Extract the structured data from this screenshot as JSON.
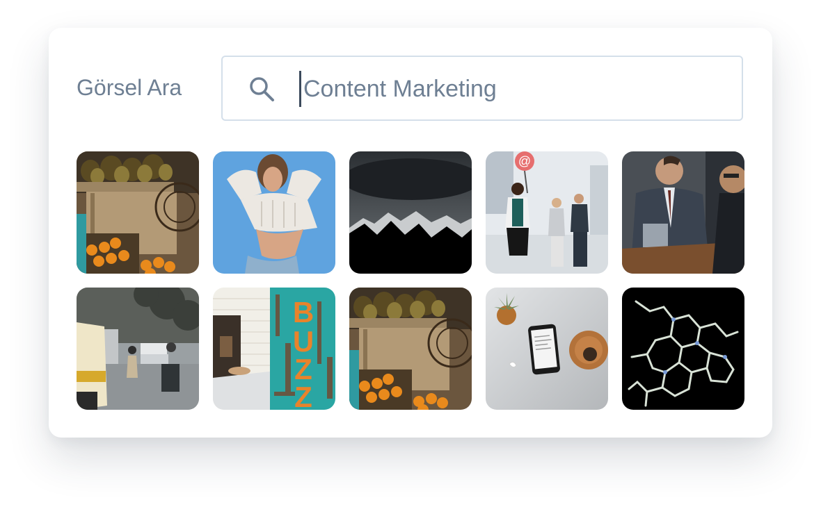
{
  "search": {
    "label": "Görsel Ara",
    "value": "Content Marketing",
    "icon": "search-icon"
  },
  "colors": {
    "label": "#6e7f93",
    "border": "#d4dfea",
    "caret": "#3c4a5c"
  },
  "images": [
    {
      "name": "fruit-stand-photo"
    },
    {
      "name": "woman-sweater-photo"
    },
    {
      "name": "dark-mountains-photo"
    },
    {
      "name": "business-people-at-sign-photo"
    },
    {
      "name": "business-meeting-photo"
    },
    {
      "name": "city-street-photo"
    },
    {
      "name": "buzz-sign-photo"
    },
    {
      "name": "fruit-stand-photo-2"
    },
    {
      "name": "desk-phone-plant-photo"
    },
    {
      "name": "molecule-structure-photo"
    }
  ]
}
